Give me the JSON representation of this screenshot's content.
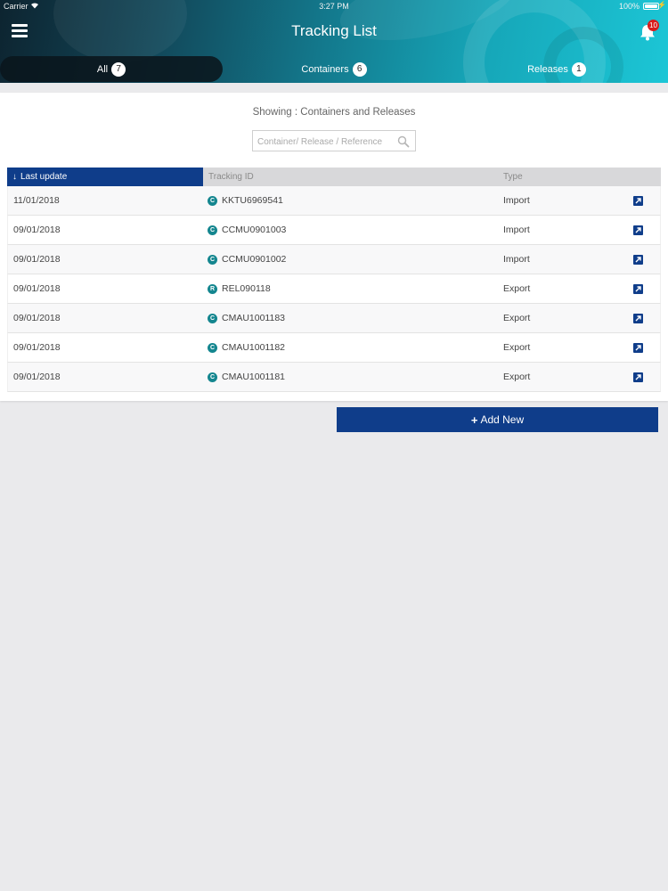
{
  "status_bar": {
    "carrier": "Carrier",
    "time": "3:27 PM",
    "battery": "100%"
  },
  "header": {
    "title": "Tracking List",
    "notification_count": "10"
  },
  "tabs": [
    {
      "label": "All",
      "count": "7",
      "active": true
    },
    {
      "label": "Containers",
      "count": "6",
      "active": false
    },
    {
      "label": "Releases",
      "count": "1",
      "active": false
    }
  ],
  "showing_text": "Showing : Containers and Releases",
  "search": {
    "placeholder": "Container/ Release / Reference",
    "value": ""
  },
  "table": {
    "columns": {
      "last_update": "Last update",
      "tracking_id": "Tracking ID",
      "type": "Type"
    },
    "rows": [
      {
        "date": "11/01/2018",
        "kind": "C",
        "id": "KKTU6969541",
        "type": "Import"
      },
      {
        "date": "09/01/2018",
        "kind": "C",
        "id": "CCMU0901003",
        "type": "Import"
      },
      {
        "date": "09/01/2018",
        "kind": "C",
        "id": "CCMU0901002",
        "type": "Import"
      },
      {
        "date": "09/01/2018",
        "kind": "R",
        "id": "REL090118",
        "type": "Export"
      },
      {
        "date": "09/01/2018",
        "kind": "C",
        "id": "CMAU1001183",
        "type": "Export"
      },
      {
        "date": "09/01/2018",
        "kind": "C",
        "id": "CMAU1001182",
        "type": "Export"
      },
      {
        "date": "09/01/2018",
        "kind": "C",
        "id": "CMAU1001181",
        "type": "Export"
      }
    ]
  },
  "add_button": {
    "label": "Add New"
  },
  "colors": {
    "primary": "#0f3d8a",
    "teal": "#14868f",
    "badge_red": "#d81b1b"
  }
}
